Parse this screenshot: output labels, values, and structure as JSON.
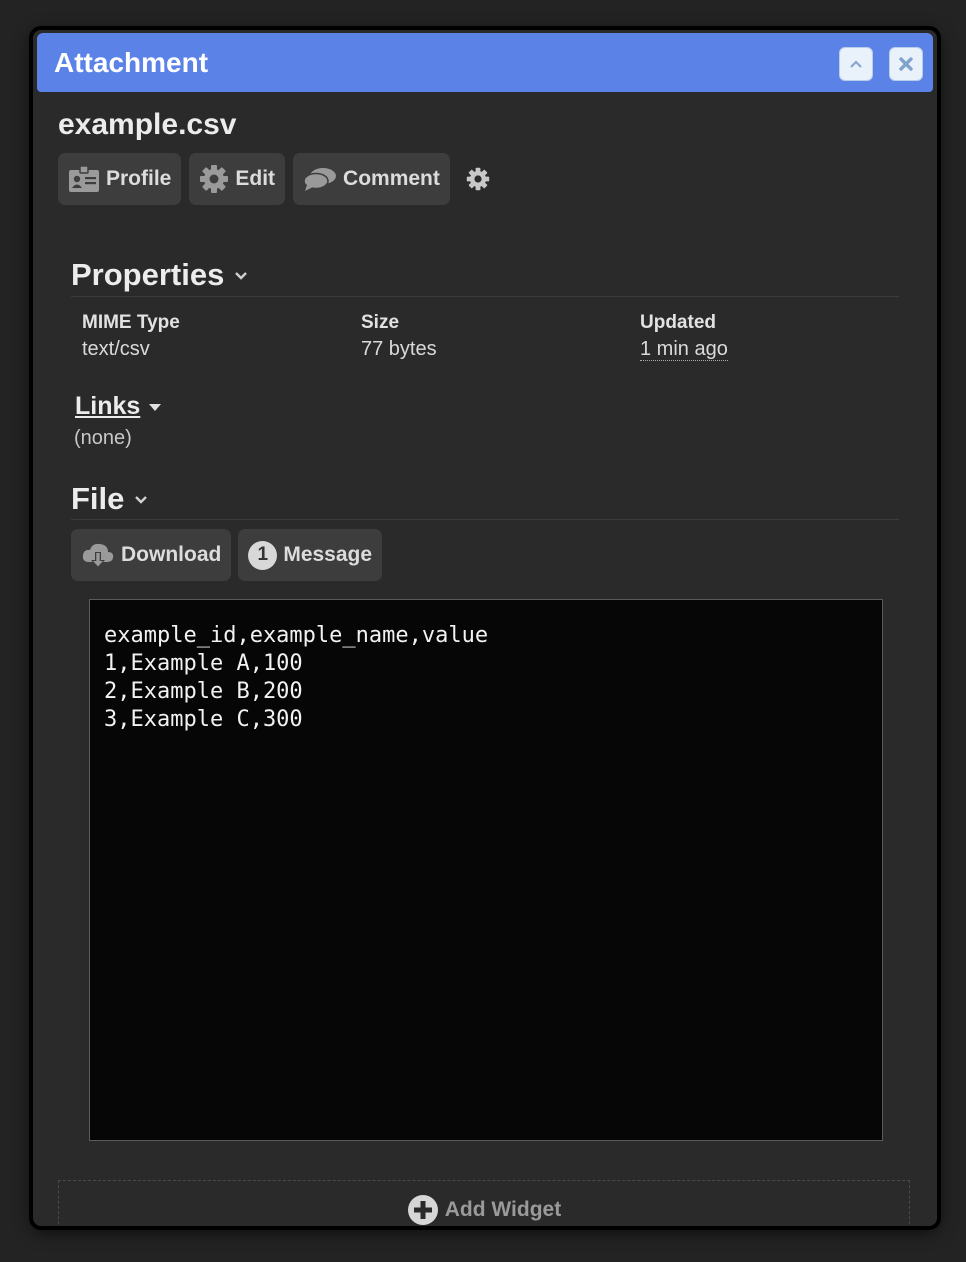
{
  "window": {
    "title": "Attachment"
  },
  "attachment": {
    "filename": "example.csv"
  },
  "actions": {
    "profile_label": "Profile",
    "edit_label": "Edit",
    "comment_label": "Comment"
  },
  "properties": {
    "heading": "Properties",
    "mime_label": "MIME Type",
    "mime_value": "text/csv",
    "size_label": "Size",
    "size_value": "77 bytes",
    "updated_label": "Updated",
    "updated_value": "1 min ago"
  },
  "links": {
    "heading": "Links",
    "value": "(none)"
  },
  "file": {
    "heading": "File",
    "download_label": "Download",
    "message_count": "1",
    "message_label": "Message",
    "content": "example_id,example_name,value\n1,Example A,100\n2,Example B,200\n3,Example C,300"
  },
  "footer": {
    "add_widget_label": "Add Widget"
  },
  "colors": {
    "titlebar": "#5b82e6",
    "background": "#232323",
    "panel": "#2a2a2a"
  }
}
